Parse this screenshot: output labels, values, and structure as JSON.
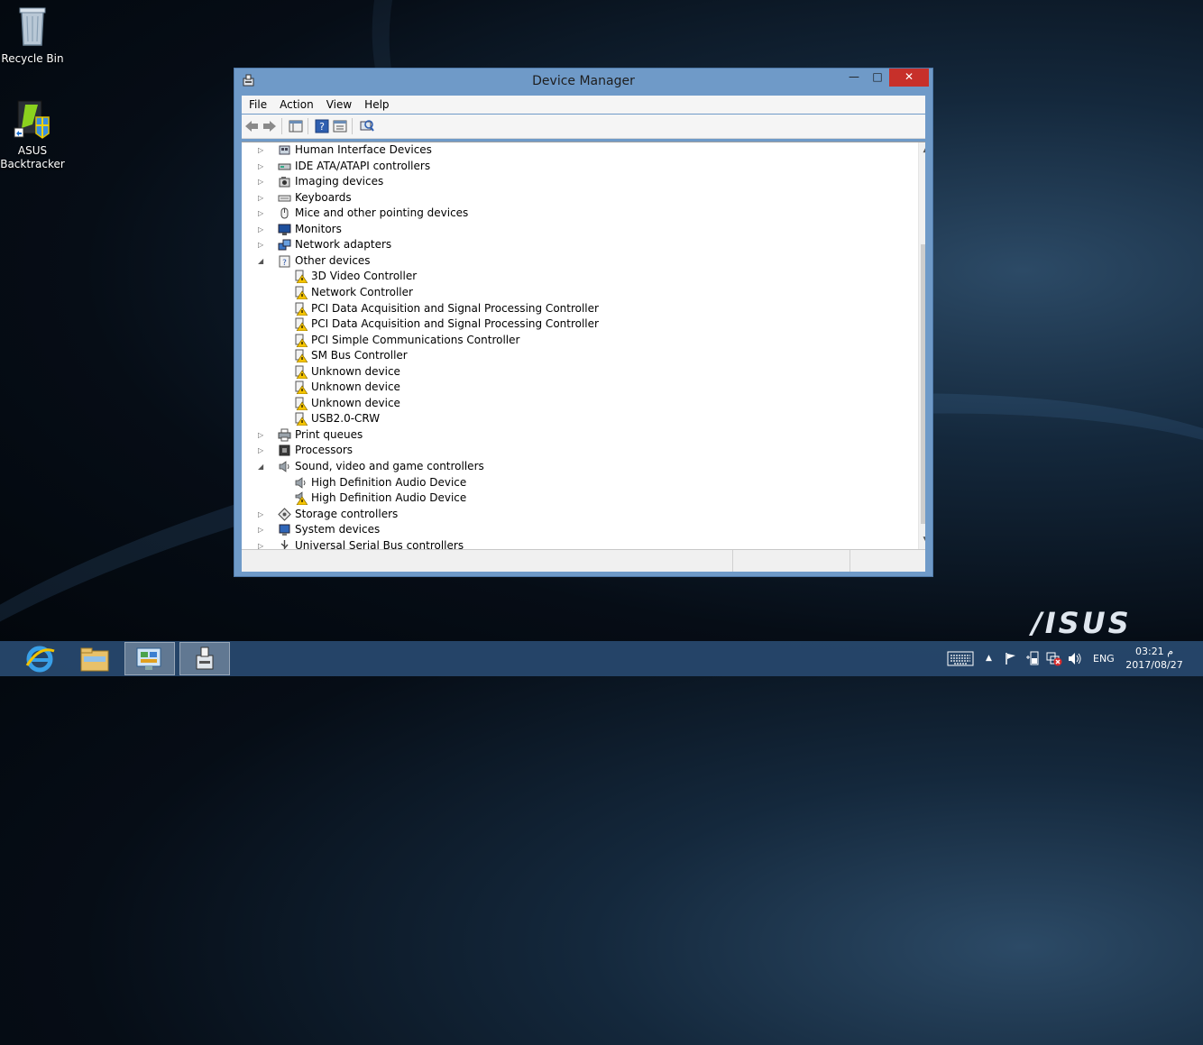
{
  "desktop": {
    "icons": [
      {
        "label": "Recycle Bin"
      },
      {
        "label": "ASUS Backtracker"
      }
    ],
    "brand": "/ISUS"
  },
  "window": {
    "title": "Device Manager",
    "menu": [
      "File",
      "Action",
      "View",
      "Help"
    ]
  },
  "tree": [
    {
      "label": "Human Interface Devices",
      "level": 0,
      "state": "collapsed",
      "icon": "hid-icon"
    },
    {
      "label": "IDE ATA/ATAPI controllers",
      "level": 0,
      "state": "collapsed",
      "icon": "ide-controller-icon"
    },
    {
      "label": "Imaging devices",
      "level": 0,
      "state": "collapsed",
      "icon": "imaging-device-icon"
    },
    {
      "label": "Keyboards",
      "level": 0,
      "state": "collapsed",
      "icon": "keyboard-icon"
    },
    {
      "label": "Mice and other pointing devices",
      "level": 0,
      "state": "collapsed",
      "icon": "mouse-icon"
    },
    {
      "label": "Monitors",
      "level": 0,
      "state": "collapsed",
      "icon": "monitor-icon"
    },
    {
      "label": "Network adapters",
      "level": 0,
      "state": "collapsed",
      "icon": "network-adapter-icon"
    },
    {
      "label": "Other devices",
      "level": 0,
      "state": "expanded",
      "icon": "unknown-device-icon"
    },
    {
      "label": "3D Video Controller",
      "level": 1,
      "icon": "warning-device-icon"
    },
    {
      "label": "Network Controller",
      "level": 1,
      "icon": "warning-device-icon"
    },
    {
      "label": "PCI Data Acquisition and Signal Processing Controller",
      "level": 1,
      "icon": "warning-device-icon"
    },
    {
      "label": "PCI Data Acquisition and Signal Processing Controller",
      "level": 1,
      "icon": "warning-device-icon"
    },
    {
      "label": "PCI Simple Communications Controller",
      "level": 1,
      "icon": "warning-device-icon"
    },
    {
      "label": "SM Bus Controller",
      "level": 1,
      "icon": "warning-device-icon"
    },
    {
      "label": "Unknown device",
      "level": 1,
      "icon": "warning-device-icon"
    },
    {
      "label": "Unknown device",
      "level": 1,
      "icon": "warning-device-icon"
    },
    {
      "label": "Unknown device",
      "level": 1,
      "icon": "warning-device-icon"
    },
    {
      "label": "USB2.0-CRW",
      "level": 1,
      "icon": "warning-device-icon"
    },
    {
      "label": "Print queues",
      "level": 0,
      "state": "collapsed",
      "icon": "printer-icon"
    },
    {
      "label": "Processors",
      "level": 0,
      "state": "collapsed",
      "icon": "processor-icon"
    },
    {
      "label": "Sound, video and game controllers",
      "level": 0,
      "state": "expanded",
      "icon": "speaker-icon"
    },
    {
      "label": "High Definition Audio Device",
      "level": 1,
      "icon": "speaker-icon"
    },
    {
      "label": "High Definition Audio Device",
      "level": 1,
      "icon": "speaker-warning-icon"
    },
    {
      "label": "Storage controllers",
      "level": 0,
      "state": "collapsed",
      "icon": "storage-controller-icon"
    },
    {
      "label": "System devices",
      "level": 0,
      "state": "collapsed",
      "icon": "system-device-icon"
    },
    {
      "label": "Universal Serial Bus controllers",
      "level": 0,
      "state": "collapsed",
      "icon": "usb-icon"
    }
  ],
  "taskbar": {
    "language": "ENG",
    "time": "03:21 م",
    "date": "2017/08/27"
  },
  "colors": {
    "close_button": "#c7302a",
    "window_frame": "#6f9ac8",
    "taskbar": "#284a70",
    "warning": "#f5c400"
  }
}
